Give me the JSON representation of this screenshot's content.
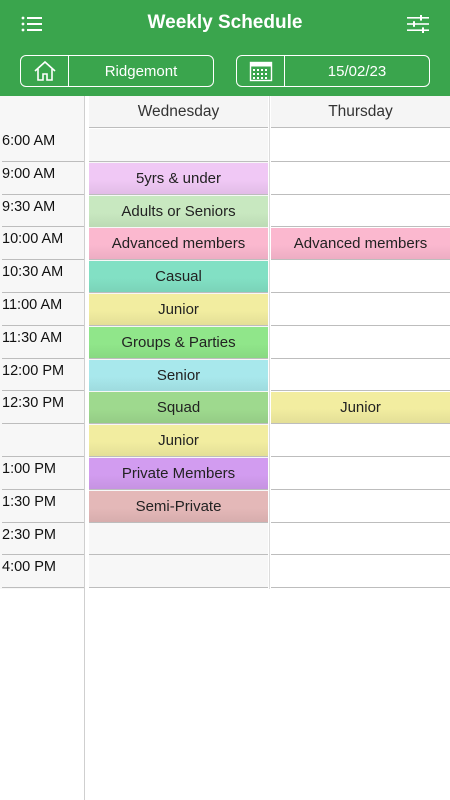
{
  "header": {
    "title": "Weekly Schedule",
    "menu_icon": "menu-icon",
    "filter_icon": "filter-sliders-icon",
    "bg_color": "#3aa54d"
  },
  "location": {
    "value": "Ridgemont",
    "icon": "home-icon"
  },
  "date": {
    "value": "15/02/23",
    "icon": "calendar-icon"
  },
  "days": [
    "Wednesday",
    "Thursday"
  ],
  "times": [
    "6:00 AM",
    "9:00 AM",
    "9:30 AM",
    "10:00 AM",
    "10:30 AM",
    "11:00 AM",
    "11:30 AM",
    "12:00 PM",
    "12:30 PM",
    "",
    "1:00 PM",
    "1:30 PM",
    "2:30 PM",
    "4:00 PM"
  ],
  "wednesday_events": [
    {
      "label": "",
      "color": ""
    },
    {
      "label": "5yrs & under",
      "color": "#f0c8f5"
    },
    {
      "label": "Adults or Seniors",
      "color": "#c8e8c0"
    },
    {
      "label": "Advanced members",
      "color": "#fbb8cf"
    },
    {
      "label": "Casual",
      "color": "#82e0c4"
    },
    {
      "label": "Junior",
      "color": "#f2eda0"
    },
    {
      "label": "Groups & Parties",
      "color": "#90e68a"
    },
    {
      "label": "Senior",
      "color": "#a8e8ec"
    },
    {
      "label": "Squad",
      "color": "#9ed98e"
    },
    {
      "label": "Junior",
      "color": "#f2eda0"
    },
    {
      "label": "Private Members",
      "color": "#d29cf0"
    },
    {
      "label": "Semi-Private",
      "color": "#e4b8b8"
    },
    {
      "label": "",
      "color": ""
    },
    {
      "label": "",
      "color": ""
    }
  ],
  "thursday_events": [
    {
      "label": "",
      "color": ""
    },
    {
      "label": "",
      "color": ""
    },
    {
      "label": "",
      "color": ""
    },
    {
      "label": "Advanced members",
      "color": "#fbb8cf"
    },
    {
      "label": "",
      "color": ""
    },
    {
      "label": "",
      "color": ""
    },
    {
      "label": "",
      "color": ""
    },
    {
      "label": "",
      "color": ""
    },
    {
      "label": "Junior",
      "color": "#f2eda0"
    },
    {
      "label": "",
      "color": ""
    },
    {
      "label": "",
      "color": ""
    },
    {
      "label": "",
      "color": ""
    },
    {
      "label": "",
      "color": ""
    },
    {
      "label": "",
      "color": ""
    }
  ]
}
